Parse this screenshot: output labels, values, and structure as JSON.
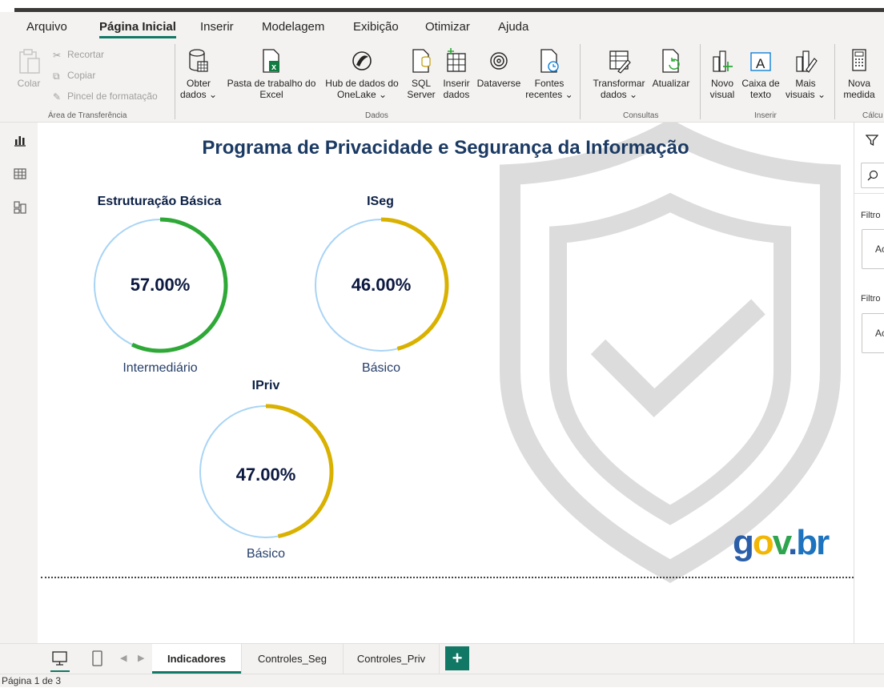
{
  "menu": {
    "tabs": [
      {
        "label": "Arquivo",
        "active": false
      },
      {
        "label": "Página Inicial",
        "active": true
      },
      {
        "label": "Inserir",
        "active": false
      },
      {
        "label": "Modelagem",
        "active": false
      },
      {
        "label": "Exibição",
        "active": false
      },
      {
        "label": "Otimizar",
        "active": false
      },
      {
        "label": "Ajuda",
        "active": false
      }
    ]
  },
  "ribbon": {
    "clipboard": {
      "paste": "Colar",
      "cut": "Recortar",
      "copy": "Copiar",
      "format_painter": "Pincel de formatação",
      "group": "Área de Transferência"
    },
    "data": {
      "get_data": [
        "Obter",
        "dados ⌄"
      ],
      "excel": [
        "Pasta de trabalho do",
        "Excel"
      ],
      "onelake": [
        "Hub de dados do",
        "OneLake ⌄"
      ],
      "sql": [
        "SQL",
        "Server"
      ],
      "enter_data": [
        "Inserir",
        "dados"
      ],
      "dataverse": [
        "Dataverse",
        ""
      ],
      "recent": [
        "Fontes",
        "recentes ⌄"
      ],
      "group": "Dados"
    },
    "queries": {
      "transform": [
        "Transformar",
        "dados ⌄"
      ],
      "refresh": [
        "Atualizar",
        ""
      ],
      "group": "Consultas"
    },
    "insert": {
      "new_visual": [
        "Novo",
        "visual"
      ],
      "text_box": [
        "Caixa de",
        "texto"
      ],
      "more_visuals": [
        "Mais",
        "visuais ⌄"
      ],
      "group": "Inserir"
    },
    "calc": {
      "new_measure": [
        "Nova",
        "medida"
      ],
      "group": "Cálcu"
    }
  },
  "report": {
    "title": "Programa de Privacidade e Segurança da Informação",
    "gauges": [
      {
        "title": "Estruturação Básica",
        "value_text": "57.00%",
        "value": 0.57,
        "level": "Intermediário",
        "color": "#2ea836"
      },
      {
        "title": "ISeg",
        "value_text": "46.00%",
        "value": 0.46,
        "level": "Básico",
        "color": "#d9b100"
      },
      {
        "title": "IPriv",
        "value_text": "47.00%",
        "value": 0.47,
        "level": "Básico",
        "color": "#d9b100"
      }
    ],
    "logo": {
      "g": "g",
      "o": "o",
      "v": "v",
      "dot": ".",
      "br": "br"
    }
  },
  "filters": {
    "label_1": "Filtro",
    "box_1": "Ac",
    "label_2": "Filtro",
    "box_2": "Ac"
  },
  "pages": {
    "tabs": [
      "Indicadores",
      "Controles_Seg",
      "Controles_Priv"
    ],
    "active": "Indicadores",
    "add": "+"
  },
  "status": {
    "page_info": "Página 1 de 3"
  },
  "colors": {
    "accent": "#117865",
    "track": "#a9d4f5",
    "title": "#1b3a63"
  }
}
